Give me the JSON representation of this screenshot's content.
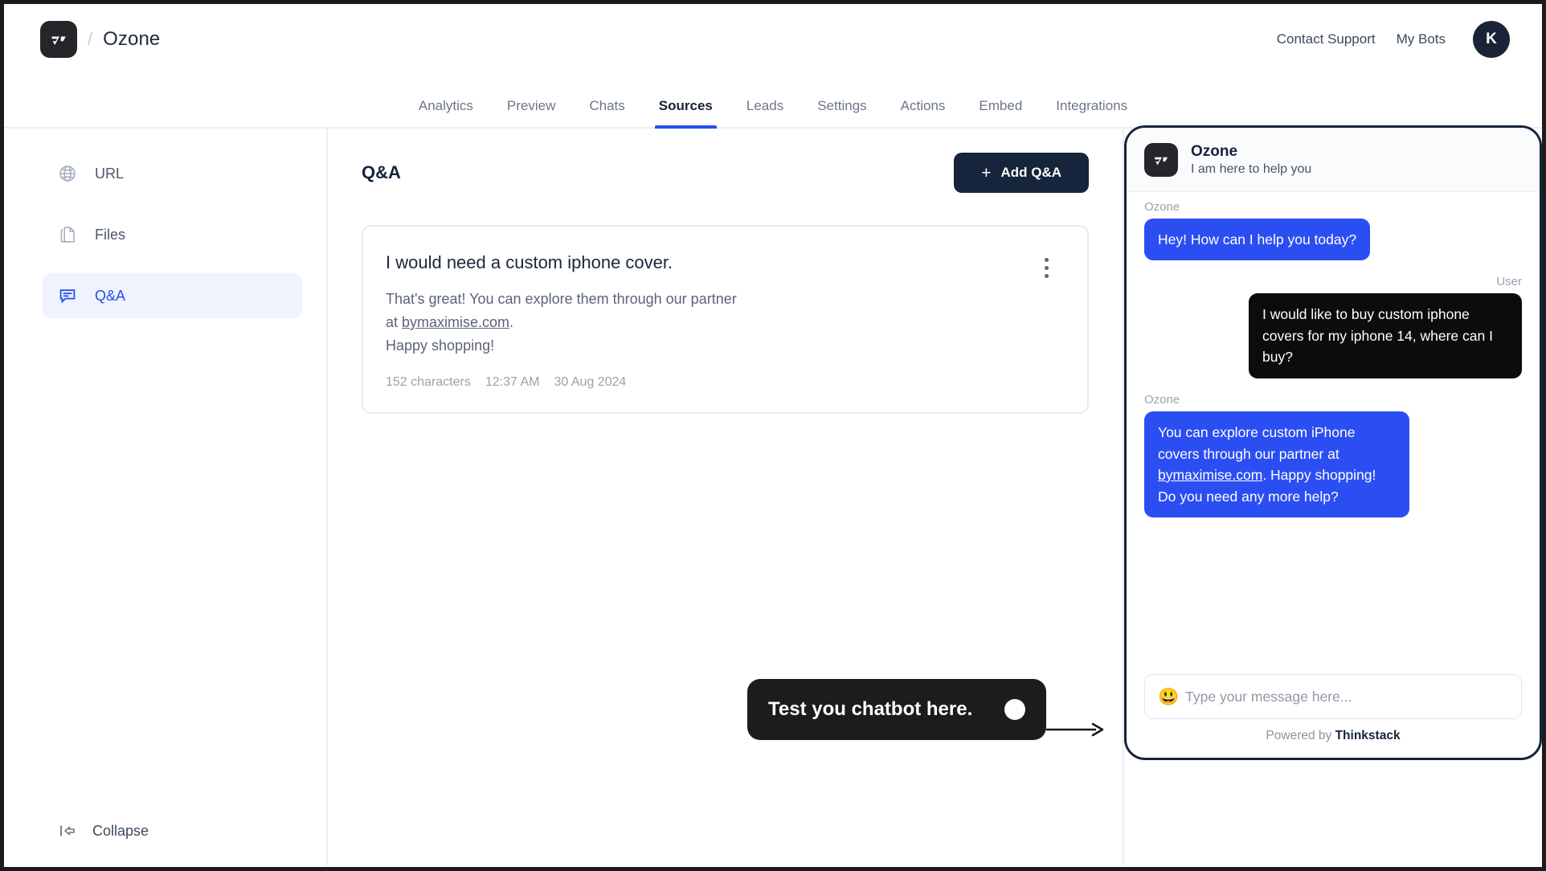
{
  "header": {
    "brand_separator": "/",
    "brand_name": "Ozone",
    "logo_icon": "thinkstack-logo-icon",
    "links": [
      {
        "label": "Contact Support",
        "name": "contact-support-link"
      },
      {
        "label": "My Bots",
        "name": "my-bots-link"
      }
    ],
    "avatar_initial": "K"
  },
  "tabs": [
    {
      "label": "Analytics",
      "active": false
    },
    {
      "label": "Preview",
      "active": false
    },
    {
      "label": "Chats",
      "active": false
    },
    {
      "label": "Sources",
      "active": true
    },
    {
      "label": "Leads",
      "active": false
    },
    {
      "label": "Settings",
      "active": false
    },
    {
      "label": "Actions",
      "active": false
    },
    {
      "label": "Embed",
      "active": false
    },
    {
      "label": "Integrations",
      "active": false
    }
  ],
  "sidebar": {
    "items": [
      {
        "label": "URL",
        "icon": "globe-icon",
        "active": false
      },
      {
        "label": "Files",
        "icon": "files-icon",
        "active": false
      },
      {
        "label": "Q&A",
        "icon": "chat-bubble-icon",
        "active": true
      }
    ],
    "collapse": {
      "label": "Collapse",
      "icon": "collapse-panel-icon"
    }
  },
  "main": {
    "panel_title": "Q&A",
    "add_button": {
      "label": "Add Q&A",
      "icon": "plus-icon"
    },
    "qa_entries": [
      {
        "question": "I would need a custom iphone cover.",
        "answer_pre": "That's great! You can explore them through our partner\nat ",
        "answer_link": "bymaximise.com",
        "answer_post": ".\nHappy shopping!",
        "characters": "152 characters",
        "time": "12:37 AM",
        "date": "30 Aug 2024",
        "menu_icon": "kebab-menu-icon"
      }
    ]
  },
  "chat_widget": {
    "logo_icon": "thinkstack-logo-icon",
    "bot_name": "Ozone",
    "bot_subtitle": "I am here to help you",
    "messages": [
      {
        "sender": "Ozone",
        "role": "bot",
        "text": "Hey! How can I help you today?"
      },
      {
        "sender": "User",
        "role": "user",
        "text": "I would like to buy custom iphone covers for my iphone 14, where can I buy?"
      },
      {
        "sender": "Ozone",
        "role": "bot",
        "text_pre": "You can explore custom iPhone covers through our partner at ",
        "link": "bymaximise.com",
        "text_post": ". Happy shopping! Do you need any more help?"
      }
    ],
    "input": {
      "placeholder": "Type your message here...",
      "value": "",
      "emoji_icon": "smiley-emoji-icon"
    },
    "footer_prefix": "Powered by ",
    "footer_brand": "Thinkstack"
  },
  "tooltip": {
    "text": "Test you chatbot here.",
    "dot_icon": "tooltip-dot-icon",
    "arrow_icon": "arrow-right-icon"
  },
  "colors": {
    "accent_blue": "#2450e8",
    "bubble_blue": "#2b4ef2",
    "dark_navy": "#16243c",
    "tooltip_black": "#1c1c1e",
    "sidebar_active_bg": "#eef3fe"
  }
}
